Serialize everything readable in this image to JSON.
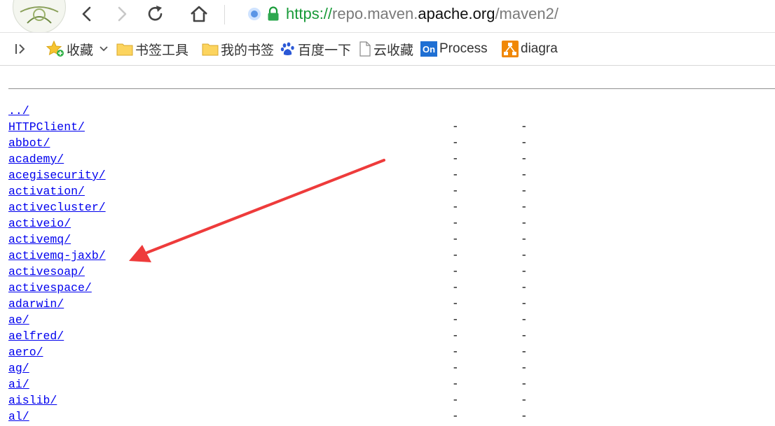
{
  "toolbar": {
    "url_scheme": "https://",
    "url_sub": "repo.maven.",
    "url_host": "apache.org",
    "url_path": "/maven2/"
  },
  "bookmarks": {
    "items": [
      {
        "label": "收藏",
        "icon": "star-icon"
      },
      {
        "label": "书签工具",
        "icon": "folder-icon"
      },
      {
        "label": "我的书签",
        "icon": "folder-icon"
      },
      {
        "label": "百度一下",
        "icon": "baidu-paw-icon"
      },
      {
        "label": "云收藏",
        "icon": "page-icon"
      },
      {
        "label": "Process",
        "icon": "processon-icon"
      },
      {
        "label": "diagra",
        "icon": "drawio-icon"
      }
    ]
  },
  "listing": {
    "rows": [
      {
        "name": "../",
        "col1": "",
        "col2": ""
      },
      {
        "name": "HTTPClient/",
        "col1": "-",
        "col2": "-"
      },
      {
        "name": "abbot/",
        "col1": "-",
        "col2": "-"
      },
      {
        "name": "academy/",
        "col1": "-",
        "col2": "-"
      },
      {
        "name": "acegisecurity/",
        "col1": "-",
        "col2": "-"
      },
      {
        "name": "activation/",
        "col1": "-",
        "col2": "-"
      },
      {
        "name": "activecluster/",
        "col1": "-",
        "col2": "-"
      },
      {
        "name": "activeio/",
        "col1": "-",
        "col2": "-"
      },
      {
        "name": "activemq/",
        "col1": "-",
        "col2": "-"
      },
      {
        "name": "activemq-jaxb/",
        "col1": "-",
        "col2": "-"
      },
      {
        "name": "activesoap/",
        "col1": "-",
        "col2": "-"
      },
      {
        "name": "activespace/",
        "col1": "-",
        "col2": "-"
      },
      {
        "name": "adarwin/",
        "col1": "-",
        "col2": "-"
      },
      {
        "name": "ae/",
        "col1": "-",
        "col2": "-"
      },
      {
        "name": "aelfred/",
        "col1": "-",
        "col2": "-"
      },
      {
        "name": "aero/",
        "col1": "-",
        "col2": "-"
      },
      {
        "name": "ag/",
        "col1": "-",
        "col2": "-"
      },
      {
        "name": "ai/",
        "col1": "-",
        "col2": "-"
      },
      {
        "name": "aislib/",
        "col1": "-",
        "col2": "-"
      },
      {
        "name": "al/",
        "col1": "-",
        "col2": "-"
      }
    ]
  },
  "colors": {
    "link": "#0000ee",
    "secure_green": "#179a38",
    "annotation_arrow": "#ee3b3b"
  }
}
